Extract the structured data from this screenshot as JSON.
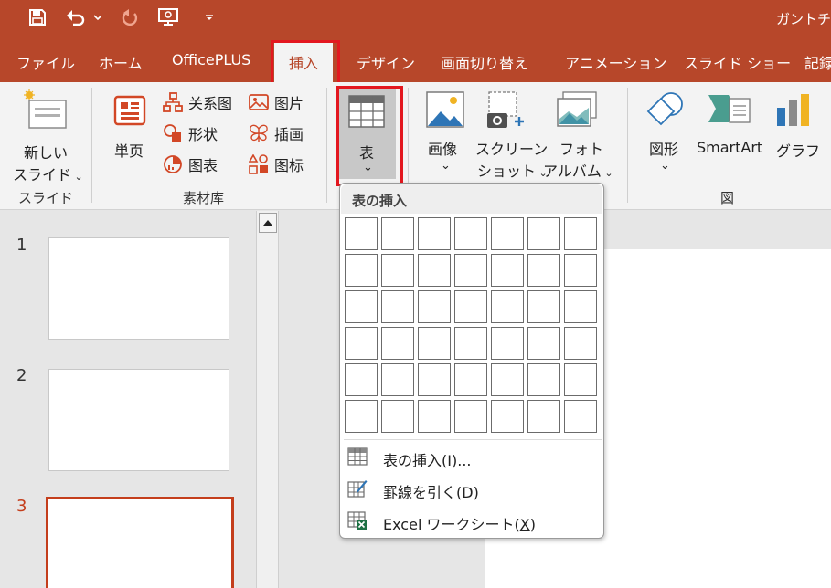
{
  "window": {
    "doc_title": "ガントチ"
  },
  "qat": {
    "save_icon": "save-icon",
    "undo_icon": "undo-icon",
    "redo_icon": "redo-icon",
    "present_icon": "presenter-icon",
    "customize_icon": "customize-qat-icon"
  },
  "tabs": {
    "file": "ファイル",
    "home": "ホーム",
    "officeplus": "OfficePLUS",
    "insert": "挿入",
    "design": "デザイン",
    "transitions": "画面切り替え",
    "animations": "アニメーション",
    "slideshow": "スライド ショー",
    "review": "記録"
  },
  "ribbon": {
    "new_slide_line1": "新しい",
    "new_slide_line2": "スライド",
    "group_slides": "スライド",
    "single_page": "単页",
    "relation_chart": "关系图",
    "shapes_cn": "形状",
    "chart_cn": "图表",
    "picture_cn": "图片",
    "illustration_cn": "插画",
    "icon_cn": "图标",
    "group_material": "素材库",
    "table": "表",
    "images": "画像",
    "screenshot_line1": "スクリーン",
    "screenshot_line2": "ショット",
    "photo_album_line1": "フォト",
    "photo_album_line2": "アルバム",
    "shapes": "図形",
    "smartart": "SmartArt",
    "chart": "グラフ",
    "group_illustrations": "図",
    "dropdown_caret": "⌄"
  },
  "slides": [
    {
      "number": "1"
    },
    {
      "number": "2"
    },
    {
      "number": "3"
    }
  ],
  "table_dropdown": {
    "header": "表の挿入",
    "grid_columns": 7,
    "grid_rows": 6,
    "items": [
      {
        "label": "表の挿入",
        "accel": "I",
        "suffix": "...",
        "icon": "table-insert-icon"
      },
      {
        "label": "罫線を引く",
        "accel": "D",
        "suffix": "",
        "icon": "draw-table-icon"
      },
      {
        "label": "Excel ワークシート",
        "accel": "X",
        "suffix": "",
        "icon": "excel-icon"
      }
    ]
  }
}
